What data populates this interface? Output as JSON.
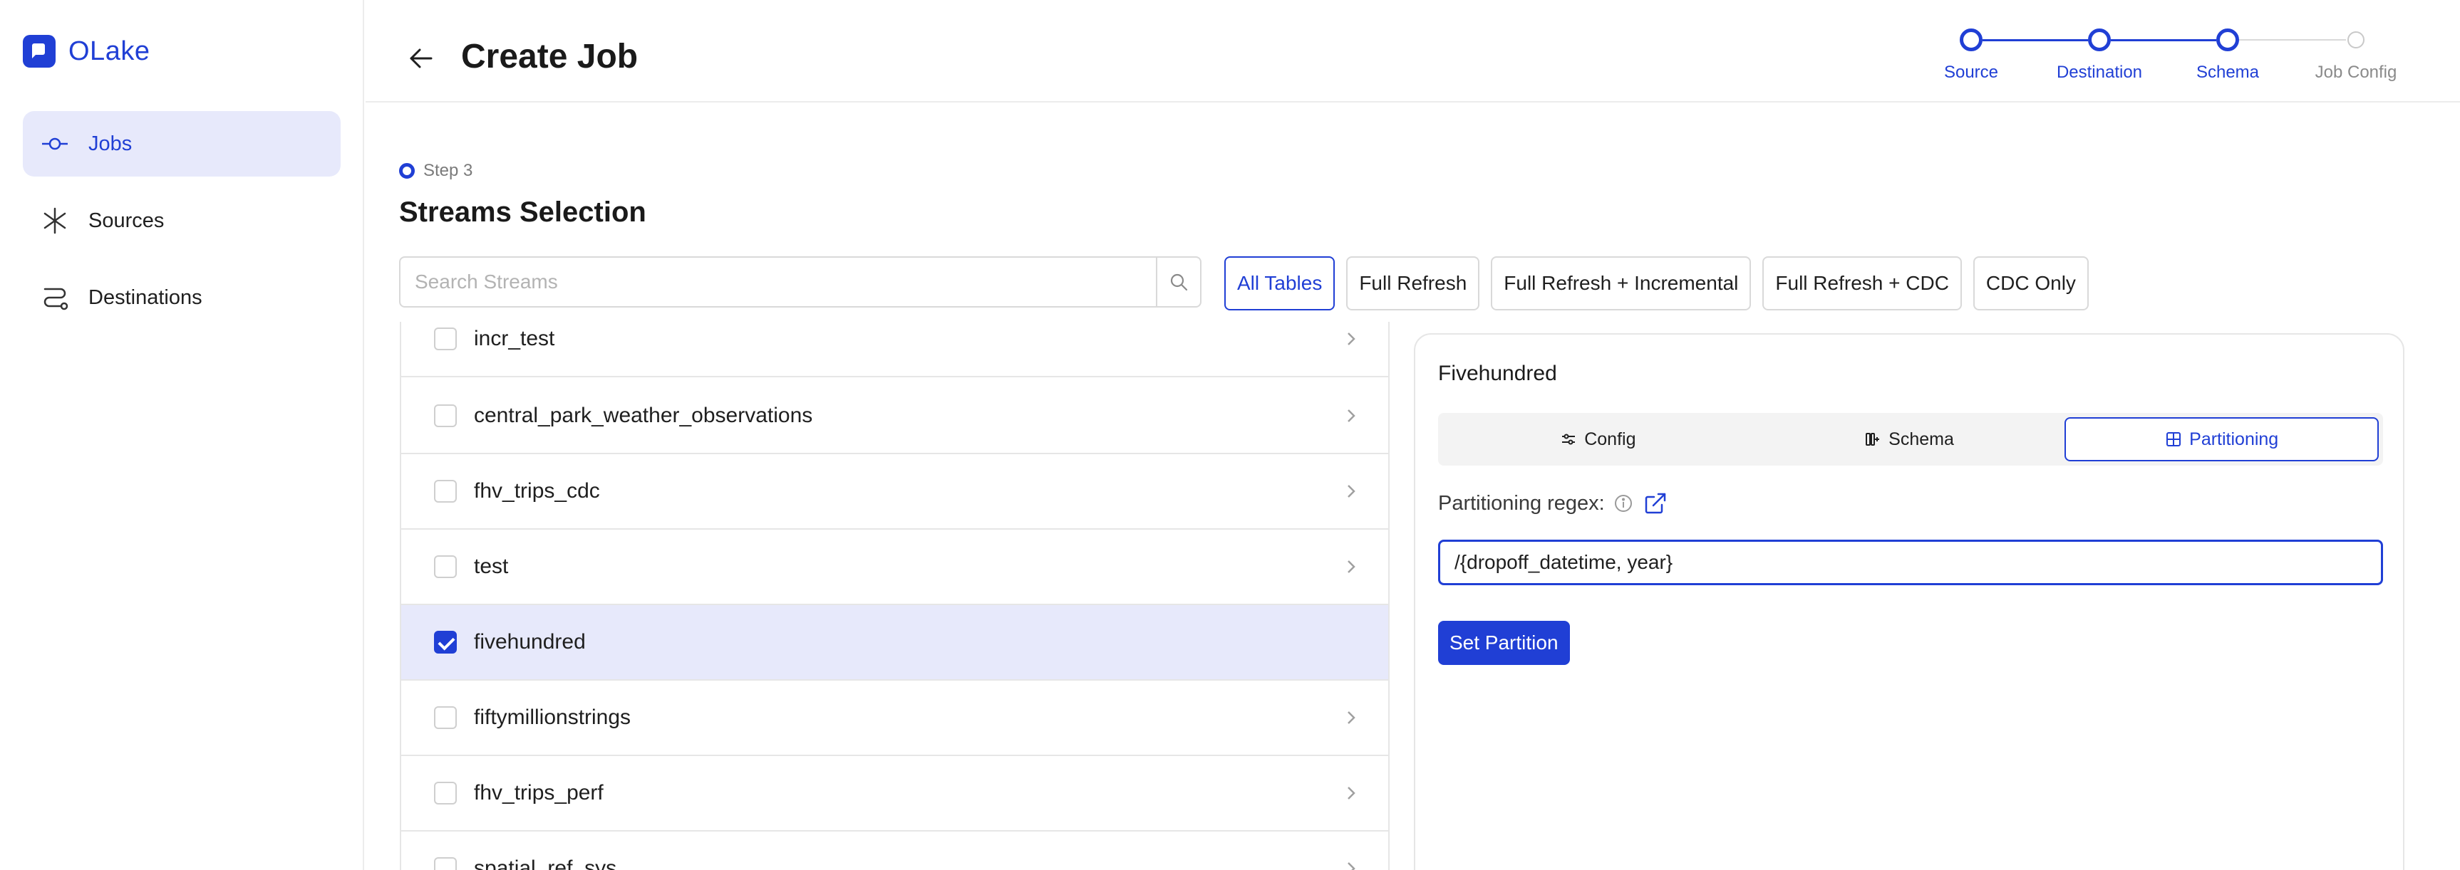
{
  "app": {
    "name": "OLake"
  },
  "sidebar": {
    "items": [
      {
        "label": "Jobs",
        "icon": "commit-icon",
        "active": true
      },
      {
        "label": "Sources",
        "icon": "asterisk-icon",
        "active": false
      },
      {
        "label": "Destinations",
        "icon": "route-icon",
        "active": false
      }
    ]
  },
  "header": {
    "title": "Create Job",
    "steps": [
      {
        "label": "Source",
        "status": "done"
      },
      {
        "label": "Destination",
        "status": "done"
      },
      {
        "label": "Schema",
        "status": "current"
      },
      {
        "label": "Job Config",
        "status": "pending"
      }
    ]
  },
  "main": {
    "step_indicator": "Step 3",
    "section_title": "Streams Selection",
    "search": {
      "placeholder": "Search Streams",
      "value": ""
    },
    "filters": [
      {
        "label": "All Tables",
        "active": true
      },
      {
        "label": "Full Refresh",
        "active": false
      },
      {
        "label": "Full Refresh + Incremental",
        "active": false
      },
      {
        "label": "Full Refresh + CDC",
        "active": false
      },
      {
        "label": "CDC Only",
        "active": false
      }
    ],
    "streams": [
      {
        "name": "incr_test",
        "checked": false,
        "selected": false
      },
      {
        "name": "central_park_weather_observations",
        "checked": false,
        "selected": false
      },
      {
        "name": "fhv_trips_cdc",
        "checked": false,
        "selected": false
      },
      {
        "name": "test",
        "checked": false,
        "selected": false
      },
      {
        "name": "fivehundred",
        "checked": true,
        "selected": true
      },
      {
        "name": "fiftymillionstrings",
        "checked": false,
        "selected": false
      },
      {
        "name": "fhv_trips_perf",
        "checked": false,
        "selected": false
      },
      {
        "name": "spatial_ref_sys",
        "checked": false,
        "selected": false
      }
    ]
  },
  "detail": {
    "title": "Fivehundred",
    "tabs": [
      {
        "label": "Config",
        "icon": "sliders-icon",
        "active": false
      },
      {
        "label": "Schema",
        "icon": "columns-icon",
        "active": false
      },
      {
        "label": "Partitioning",
        "icon": "grid-icon",
        "active": true
      }
    ],
    "regex_label": "Partitioning regex:",
    "regex_value": "/{dropoff_datetime, year}",
    "set_button": "Set Partition"
  },
  "colors": {
    "accent": "#203fd5",
    "accent_bg": "#e7e9fb",
    "border": "#e6e6e6"
  }
}
